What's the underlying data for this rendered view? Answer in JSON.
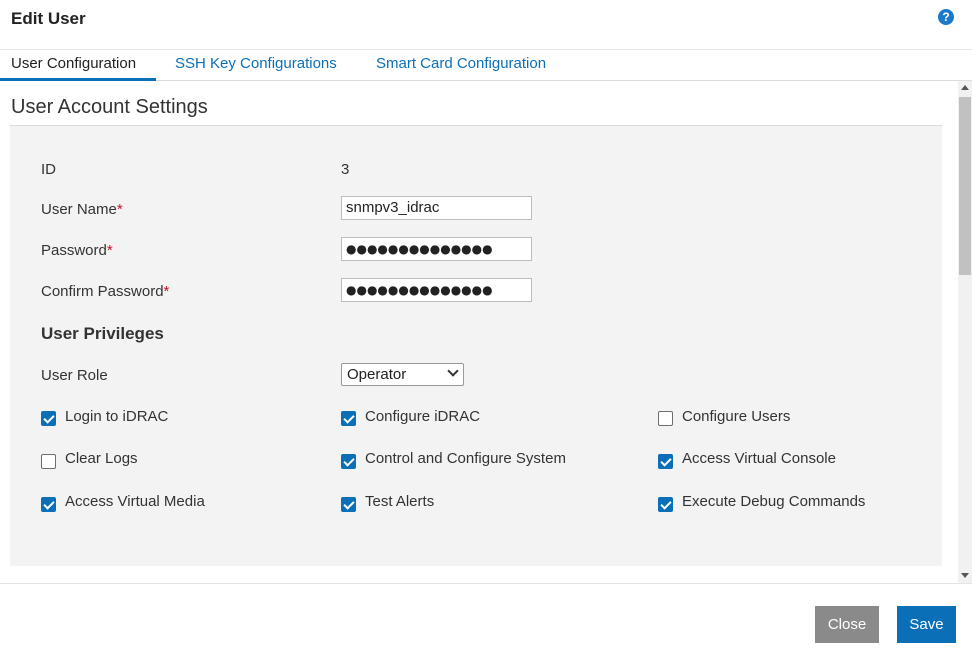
{
  "dialog": {
    "title": "Edit User",
    "help_icon": "?"
  },
  "tabs": [
    {
      "label": "User Configuration",
      "active": true
    },
    {
      "label": "SSH Key Configurations",
      "active": false
    },
    {
      "label": "Smart Card Configuration",
      "active": false
    }
  ],
  "section": {
    "title": "User Account Settings"
  },
  "form": {
    "id_label": "ID",
    "id_value": "3",
    "username_label": "User Name",
    "username_value": "snmpv3_idrac",
    "password_label": "Password",
    "password_value": "●●●●●●●●●●●●●●",
    "confirm_label": "Confirm Password",
    "confirm_value": "●●●●●●●●●●●●●●",
    "required_mark": "*"
  },
  "privileges": {
    "title": "User Privileges",
    "role_label": "User Role",
    "role_value": "Operator",
    "items": [
      {
        "label": "Login to iDRAC",
        "checked": true
      },
      {
        "label": "Configure iDRAC",
        "checked": true
      },
      {
        "label": "Configure Users",
        "checked": false
      },
      {
        "label": "Clear Logs",
        "checked": false
      },
      {
        "label": "Control and Configure System",
        "checked": true
      },
      {
        "label": "Access Virtual Console",
        "checked": true
      },
      {
        "label": "Access Virtual Media",
        "checked": true
      },
      {
        "label": "Test Alerts",
        "checked": true
      },
      {
        "label": "Execute Debug Commands",
        "checked": true
      }
    ]
  },
  "footer": {
    "close_label": "Close",
    "save_label": "Save"
  },
  "colors": {
    "accent": "#0b6fb7",
    "required": "#c8102e",
    "panel": "#f3f3f3",
    "close_button": "#8a8a8a"
  }
}
